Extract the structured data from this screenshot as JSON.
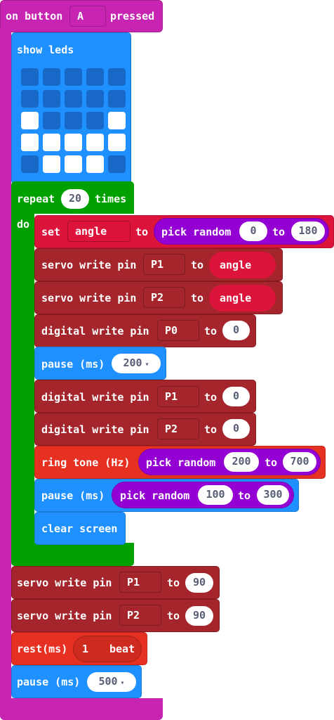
{
  "event": {
    "prefix": "on button",
    "button": "A",
    "suffix": "pressed",
    "color": "#C724B1"
  },
  "show_leds": {
    "label": "show leds",
    "color": "#1E90FF",
    "grid": [
      [
        0,
        0,
        0,
        0,
        0
      ],
      [
        0,
        0,
        0,
        0,
        0
      ],
      [
        1,
        0,
        0,
        0,
        1
      ],
      [
        1,
        1,
        1,
        1,
        1
      ],
      [
        0,
        1,
        1,
        1,
        0
      ]
    ]
  },
  "repeat": {
    "label": "repeat",
    "count": "20",
    "suffix": "times",
    "do": "do",
    "color": "#00A000"
  },
  "set_block": {
    "set": "set",
    "var": "angle",
    "to": "to",
    "random": "pick random",
    "from": "0",
    "to2": "to",
    "max": "180"
  },
  "servo_p1": {
    "label": "servo write pin",
    "pin": "P1",
    "to": "to",
    "value": "angle"
  },
  "servo_p2": {
    "label": "servo write pin",
    "pin": "P2",
    "to": "to",
    "value": "angle"
  },
  "dw_p0": {
    "label": "digital write pin",
    "pin": "P0",
    "to": "to",
    "value": "0"
  },
  "pause1": {
    "label": "pause (ms)",
    "value": "200",
    "caret": "▾"
  },
  "dw_p1": {
    "label": "digital write pin",
    "pin": "P1",
    "to": "to",
    "value": "0"
  },
  "dw_p2": {
    "label": "digital write pin",
    "pin": "P2",
    "to": "to",
    "value": "0"
  },
  "ring": {
    "label": "ring tone (Hz)",
    "random": "pick random",
    "from": "200",
    "to": "to",
    "max": "700"
  },
  "pause2": {
    "label": "pause (ms)",
    "random": "pick random",
    "from": "100",
    "to": "to",
    "max": "300"
  },
  "clear": {
    "label": "clear screen"
  },
  "servo_end1": {
    "label": "servo write pin",
    "pin": "P1",
    "to": "to",
    "value": "90"
  },
  "servo_end2": {
    "label": "servo write pin",
    "pin": "P2",
    "to": "to",
    "value": "90"
  },
  "rest": {
    "label": "rest(ms)",
    "value": "1",
    "unit": "beat"
  },
  "pause3": {
    "label": "pause (ms)",
    "value": "500",
    "caret": "▾"
  },
  "colors": {
    "pins": "#A4262C",
    "basic": "#1E90FF",
    "math": "#9400D3",
    "music": "#E63022",
    "variables": "#DC143C",
    "loops": "#00A000"
  }
}
